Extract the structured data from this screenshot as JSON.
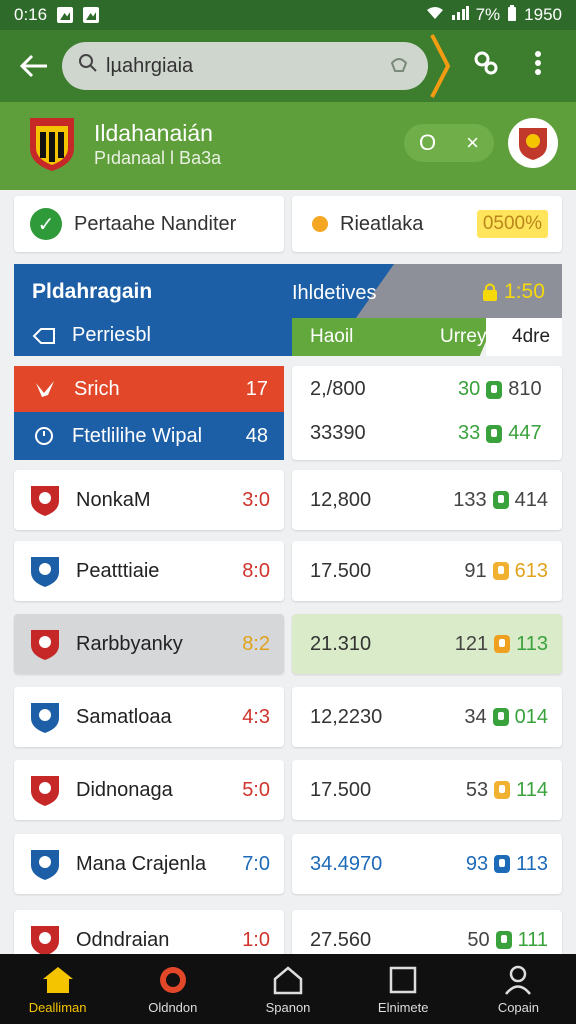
{
  "status_bar": {
    "time": "0:16",
    "battery": "7%",
    "right_time": "1950"
  },
  "toolbar": {
    "search_value": "lµahrgiaia",
    "back_icon": "back-arrow-icon",
    "menu_icon": "more-vert-icon"
  },
  "team_header": {
    "title": "Ildahanaián",
    "subtitle": "Pıdanaal l Ba3a",
    "pill_left": "O",
    "pill_right": "×"
  },
  "top_chips": [
    {
      "label": "Pertaahe Nanditer"
    },
    {
      "label": "Rieatlaka",
      "badge": "0500%"
    }
  ],
  "panel": {
    "title": "Pldahragain",
    "subtitle": "Perriesbl",
    "right_title": "Ihldetives",
    "right_value": "1:50",
    "col_a": "Haoil",
    "col_b": "Urrey",
    "col_c": "4dre"
  },
  "top_rows": [
    {
      "label": "Srich",
      "score": "17",
      "right_a": "2,/800",
      "right_b": "30",
      "right_c": "810"
    },
    {
      "label": "Ftetlilihe Wipal",
      "score": "48",
      "right_a": "33390",
      "right_b": "33",
      "right_c": "447"
    }
  ],
  "rows": [
    {
      "name": "NonkaM",
      "score": "3:0",
      "val": "12,800",
      "a": "133",
      "b": "414",
      "score_color": "#d0342c",
      "a_color": "#444",
      "b_color": "#444",
      "icon_color": "#3aa23c"
    },
    {
      "name": "Peatttiaie",
      "score": "8:0",
      "val": "17.500",
      "a": "91",
      "b": "613",
      "score_color": "#d0342c",
      "a_color": "#444",
      "b_color": "#e0a21a",
      "icon_color": "#f0b030"
    },
    {
      "name": "Rarbbyanky",
      "score": "8:2",
      "val": "21.310",
      "a": "121",
      "b": "113",
      "score_color": "#e0a21a",
      "a_color": "#444",
      "b_color": "#3aa23c",
      "icon_color": "#f0a020"
    },
    {
      "name": "Samatloaa",
      "score": "4:3",
      "val": "12,2230",
      "a": "34",
      "b": "014",
      "score_color": "#d0342c",
      "a_color": "#444",
      "b_color": "#3aa23c",
      "icon_color": "#3aa23c"
    },
    {
      "name": "Didnonaga",
      "score": "5:0",
      "val": "17.500",
      "a": "53",
      "b": "114",
      "score_color": "#d0342c",
      "a_color": "#444",
      "b_color": "#3aa23c",
      "icon_color": "#f0b030"
    },
    {
      "name": "Mana Crajenla",
      "score": "7:0",
      "val": "34.4970",
      "a": "93",
      "b": "113",
      "score_color": "#1d6ab8",
      "a_color": "#1d6ab8",
      "b_color": "#1d6ab8",
      "icon_color": "#1d6ab8"
    },
    {
      "name": "Odndraian",
      "score": "1:0",
      "val": "27.560",
      "a": "50",
      "b": "111",
      "score_color": "#d0342c",
      "a_color": "#444",
      "b_color": "#3aa23c",
      "icon_color": "#3aa23c"
    }
  ],
  "bottom_nav": [
    {
      "label": "Dealliman",
      "icon": "home-icon"
    },
    {
      "label": "Oldndon",
      "icon": "record-icon"
    },
    {
      "label": "Spanon",
      "icon": "house-outline-icon"
    },
    {
      "label": "Elnimete",
      "icon": "square-icon"
    },
    {
      "label": "Copain",
      "icon": "person-icon"
    }
  ],
  "colors": {
    "status_green": "#2e6b2a",
    "toolbar_green": "#3d7d2e",
    "header_green": "#5f9f3b",
    "blue": "#1d5fa6",
    "red": "#e2472a",
    "accent_yellow": "#f5c400"
  }
}
